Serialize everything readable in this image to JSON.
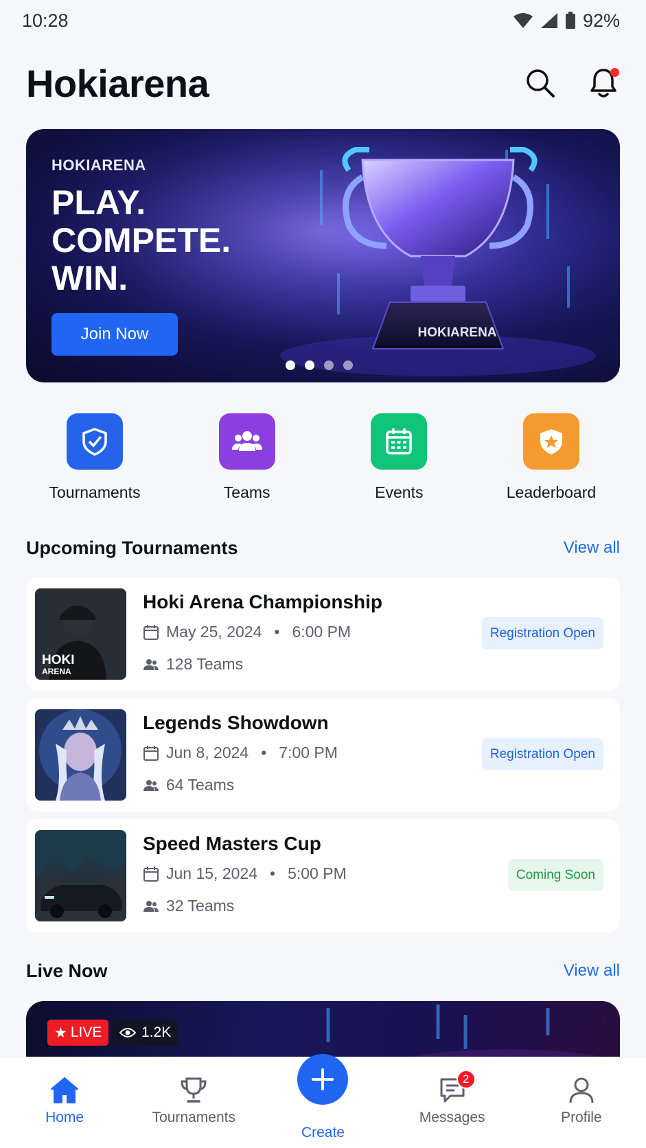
{
  "status_bar": {
    "time": "10:28",
    "battery": "92%"
  },
  "header": {
    "title": "Hokiarena"
  },
  "hero": {
    "kicker": "HOKIARENA",
    "headline": "PLAY. COMPETE. WIN.",
    "headline_lines": [
      "PLAY.",
      "COMPETE.",
      "WIN."
    ],
    "cta_label": "Join Now",
    "trophy_plate": "HOKIARENA",
    "slides_total": 4,
    "active_slide": 1
  },
  "quick_actions": [
    {
      "label": "Tournaments",
      "icon": "shield-icon",
      "color": "#2563eb"
    },
    {
      "label": "Teams",
      "icon": "users-icon",
      "color": "#8b3fe0"
    },
    {
      "label": "Events",
      "icon": "calendar-icon",
      "color": "#10c47a"
    },
    {
      "label": "Leaderboard",
      "icon": "star-shield-icon",
      "color": "#f59a2e"
    }
  ],
  "upcoming": {
    "title": "Upcoming Tournaments",
    "view_all": "View all",
    "items": [
      {
        "name": "Hoki Arena Championship",
        "date": "May 25, 2024",
        "time": "6:00 PM",
        "teams": "128 Teams",
        "status": "Registration Open",
        "thumb_label_1": "HOKI",
        "thumb_label_2": "ARENA"
      },
      {
        "name": "Legends Showdown",
        "date": "Jun 8, 2024",
        "time": "7:00 PM",
        "teams": "64 Teams",
        "status": "Registration Open"
      },
      {
        "name": "Speed Masters Cup",
        "date": "Jun 15, 2024",
        "time": "5:00 PM",
        "teams": "32 Teams",
        "status": "Coming Soon"
      }
    ]
  },
  "live": {
    "title": "Live Now",
    "view_all": "View all",
    "badge": "LIVE",
    "viewers": "1.2K"
  },
  "bottom_nav": {
    "items": [
      {
        "label": "Home",
        "icon": "home-icon",
        "active": true
      },
      {
        "label": "Tournaments",
        "icon": "trophy-icon"
      },
      {
        "label": "Create",
        "icon": "plus-icon"
      },
      {
        "label": "Messages",
        "icon": "message-icon",
        "badge": "2"
      },
      {
        "label": "Profile",
        "icon": "user-icon"
      }
    ]
  },
  "colors": {
    "accent": "#2166f3",
    "live_red": "#ee1c24"
  }
}
